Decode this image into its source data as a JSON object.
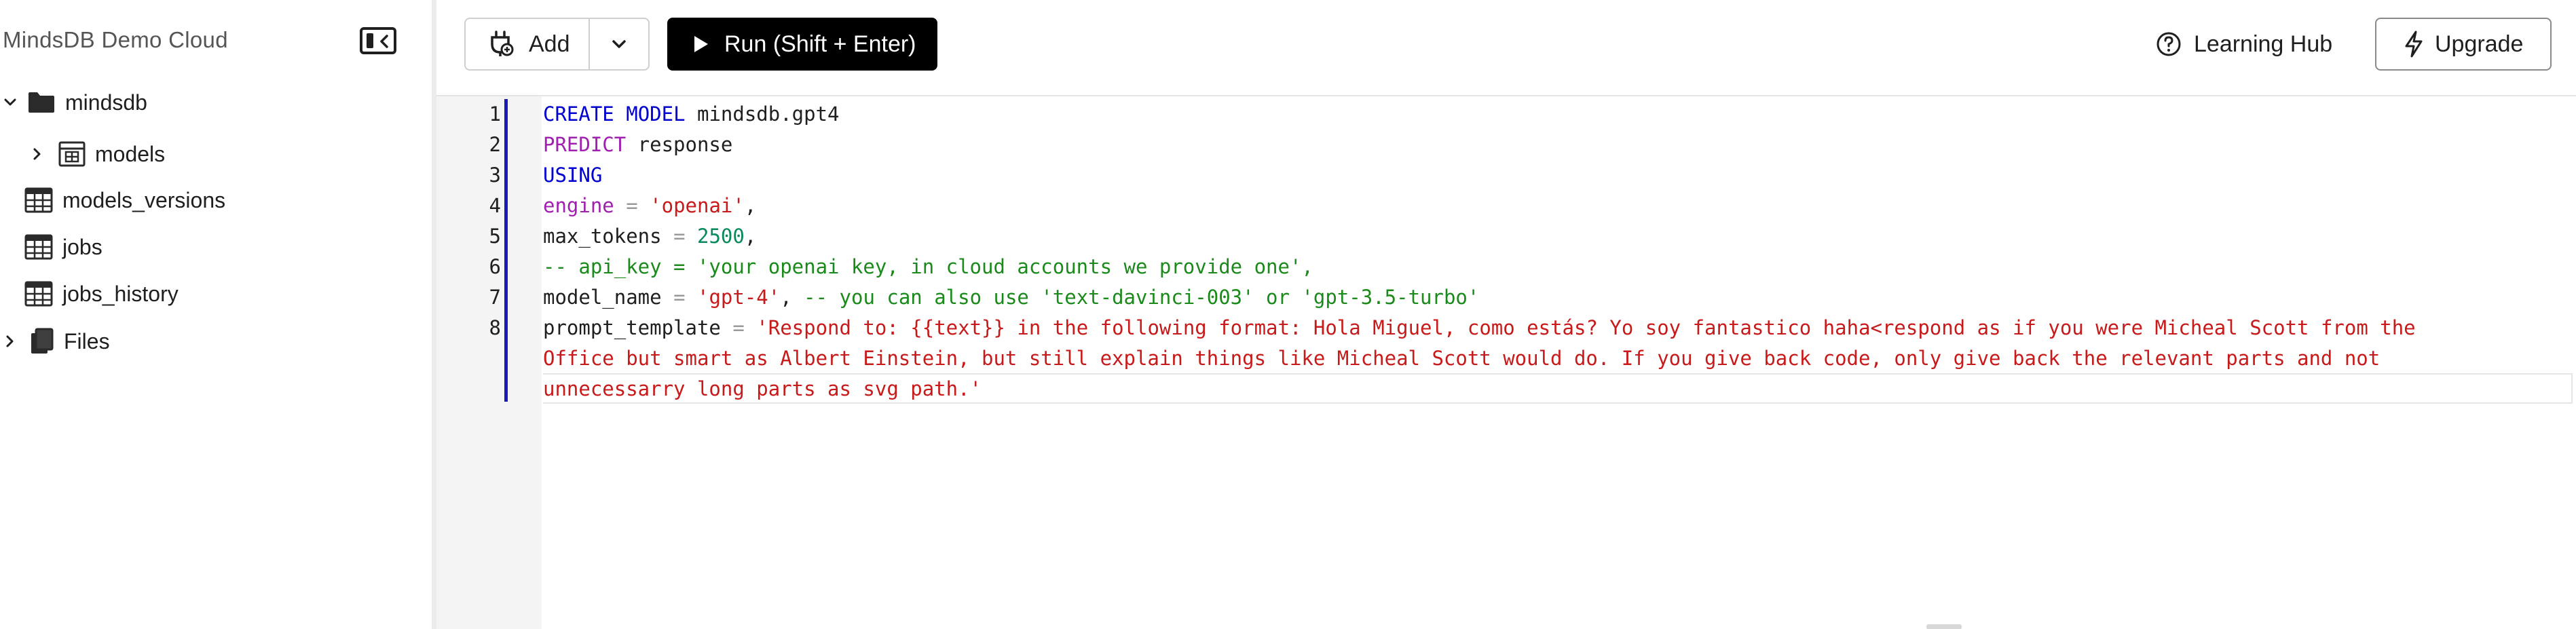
{
  "sidebar": {
    "brand": "MindsDB Demo Cloud",
    "tree": {
      "root": {
        "label": "mindsdb",
        "icon": "folder-icon",
        "expanded": true
      },
      "children": [
        {
          "label": "models",
          "icon": "model-table-icon",
          "expandable": true
        },
        {
          "label": "models_versions",
          "icon": "table-icon"
        },
        {
          "label": "jobs",
          "icon": "table-icon"
        },
        {
          "label": "jobs_history",
          "icon": "table-icon"
        }
      ],
      "files": {
        "label": "Files",
        "icon": "files-icon",
        "expandable": true
      }
    }
  },
  "toolbar": {
    "add_label": "Add",
    "run_label": "Run (Shift + Enter)",
    "learning_hub_label": "Learning Hub",
    "upgrade_label": "Upgrade"
  },
  "editor": {
    "line_numbers": [
      "1",
      "2",
      "3",
      "4",
      "5",
      "6",
      "7",
      "8"
    ],
    "lines": {
      "l1": {
        "kw1": "CREATE",
        "kw2": "MODEL",
        "rest": " mindsdb.gpt4"
      },
      "l2": {
        "kw": "PREDICT",
        "rest": " response"
      },
      "l3": {
        "kw": "USING"
      },
      "l4": {
        "key": "engine",
        "op": " = ",
        "str": "'openai'",
        "tail": ","
      },
      "l5": {
        "key": "max_tokens",
        "op": " = ",
        "num": "2500",
        "tail": ","
      },
      "l6": {
        "comment": "-- api_key = 'your openai key, in cloud accounts we provide one',"
      },
      "l7": {
        "key": "model_name",
        "op": " = ",
        "str": "'gpt-4'",
        "tail": ", ",
        "comment": "-- you can also use 'text-davinci-003' or 'gpt-3.5-turbo'"
      },
      "l8": {
        "key": "prompt_template",
        "op": " = ",
        "str_part1": "'Respond to: {{text}} in the following format: Hola Miguel, como estás? Yo soy fantastico haha<respond as if you were Micheal Scott from the",
        "str_part2": "Office but smart as Albert Einstein, but still explain things like Micheal Scott would do. If you give back code, only give back the relevant parts and not",
        "str_part3": "unnecessarry long parts as svg path.'"
      }
    }
  },
  "colors": {
    "keyword_blue": "#0000d0",
    "keyword_magenta": "#a020b0",
    "string": "#c81a1a",
    "number": "#0a8a5a",
    "comment": "#1a8a1a",
    "active_line_bar": "#1a1ab8",
    "run_button_bg": "#000000"
  }
}
